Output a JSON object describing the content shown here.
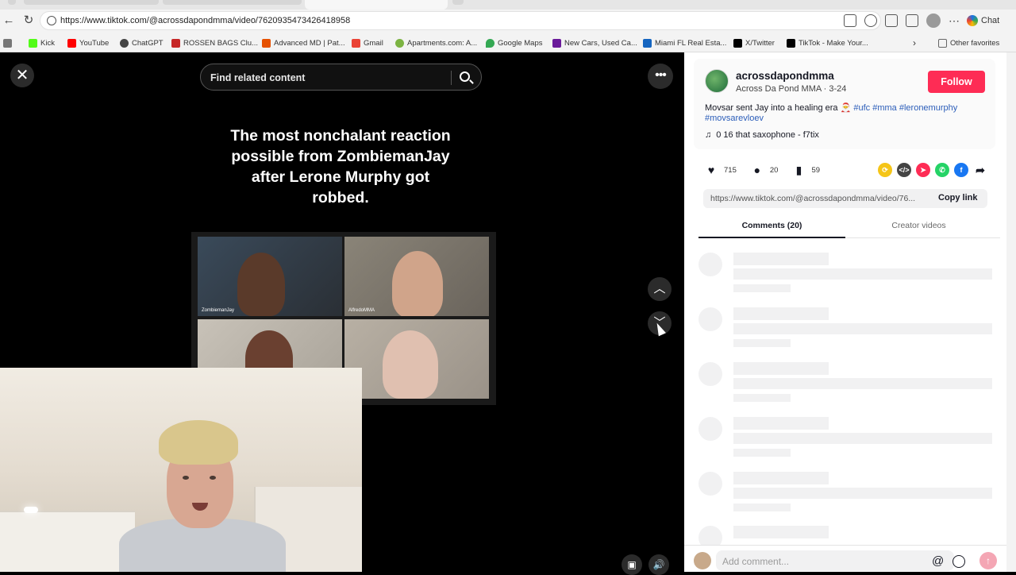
{
  "browser": {
    "url": "https://www.tiktok.com/@acrossdapondmma/video/7620935473426418958",
    "chat_label": "Chat",
    "bookmarks": [
      {
        "label": "Kick",
        "color": "#53fc18"
      },
      {
        "label": "YouTube",
        "color": "#ff0000"
      },
      {
        "label": "ChatGPT",
        "color": "#444444"
      },
      {
        "label": "ROSSEN BAGS Clu...",
        "color": "#c62828"
      },
      {
        "label": "Advanced MD | Pat...",
        "color": "#e65100"
      },
      {
        "label": "Gmail",
        "color": "#ea4335"
      },
      {
        "label": "Apartments.com: A...",
        "color": "#7cb342"
      },
      {
        "label": "Google Maps",
        "color": "#34a853"
      },
      {
        "label": "New Cars, Used Ca...",
        "color": "#6a1b9a"
      },
      {
        "label": "Miami FL Real Esta...",
        "color": "#1565c0"
      },
      {
        "label": "X/Twitter",
        "color": "#000000"
      },
      {
        "label": "TikTok - Make Your...",
        "color": "#000000"
      }
    ],
    "other_favorites": "Other favorites"
  },
  "player": {
    "search_placeholder": "Find related content",
    "caption": "The most nonchalant reaction possible from ZombiemanJay after Lerone Murphy got robbed.",
    "tile_names": [
      "ZombiemanJay",
      "AlfredoMMA",
      "",
      ""
    ]
  },
  "sidebar": {
    "username": "acrossdapondmma",
    "display_name": "Across Da Pond MMA",
    "date": "3-24",
    "follow_label": "Follow",
    "description_text": "Movsar sent Jay into a healing era",
    "hashtags": [
      "#ufc",
      "#mma",
      "#leronemurphy",
      "#movsarevloev"
    ],
    "music": "0 16 that saxophone - f7tix",
    "likes": "715",
    "comments": "20",
    "saves": "59",
    "link": "https://www.tiktok.com/@acrossdapondmma/video/76...",
    "copy_label": "Copy link",
    "tab_comments": "Comments (20)",
    "tab_creator": "Creator videos",
    "add_comment_placeholder": "Add comment..."
  },
  "colors": {
    "accent": "#fe2c55",
    "hashtag": "#2b5db9"
  }
}
